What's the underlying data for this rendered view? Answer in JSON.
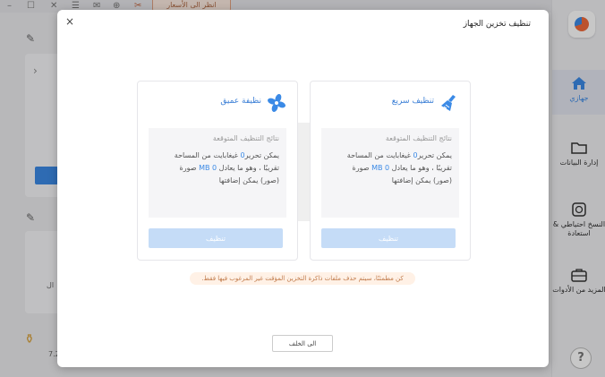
{
  "modal": {
    "title": "تنظيف تخزين الجهاز",
    "close_symbol": "×",
    "back_label": "الى الخلف",
    "notice": "كن مطمئنًا، سيتم حذف ملفات ذاكرة التخزين المؤقت غير المرغوب فيها فقط."
  },
  "quick": {
    "title": "تنظيف سريع",
    "result_header": "نتائج التنظيف المتوقعة",
    "line1_a": "يمكن تحرير",
    "line1_num": "0",
    "line1_b": "غيغابايت من المساحة",
    "line2_a": "تقريبًا ، وهو ما يعادل",
    "line2_num": "0 MB",
    "line2_b": "صورة",
    "line3": "(صور) يمكن إضافتها",
    "button": "تنظيف",
    "icon": "broom-icon"
  },
  "deep": {
    "title": "نظيفة عميق",
    "result_header": "نتائج التنظيف المتوقعة",
    "line1_a": "يمكن تحرير",
    "line1_num": "0",
    "line1_b": "غيغابايت من المساحة",
    "line2_a": "تقريبًا ، وهو ما يعادل",
    "line2_num": "0 MB",
    "line2_b": "صورة",
    "line3": "(صور) يمكن إضافتها",
    "button": "تنظيف",
    "icon": "fan-icon"
  },
  "sidebar": {
    "items": [
      {
        "label": "جهازي",
        "icon": "home-icon"
      },
      {
        "label": "إدارة البيانات",
        "icon": "folder-icon"
      },
      {
        "label": "النسخ احتياطي & استعادة",
        "icon": "backup-icon"
      },
      {
        "label": "المزيد من الأدوات",
        "icon": "toolbox-icon"
      }
    ],
    "help_symbol": "?"
  },
  "background": {
    "chip_label": "انظر الى الأسعار",
    "side_text": "ال",
    "corner_text": "7.2"
  },
  "colors": {
    "accent": "#3b8ae6",
    "button_disabled": "#c5dcf7",
    "notice_bg": "#fff1e6",
    "notice_text": "#c07a4a"
  }
}
